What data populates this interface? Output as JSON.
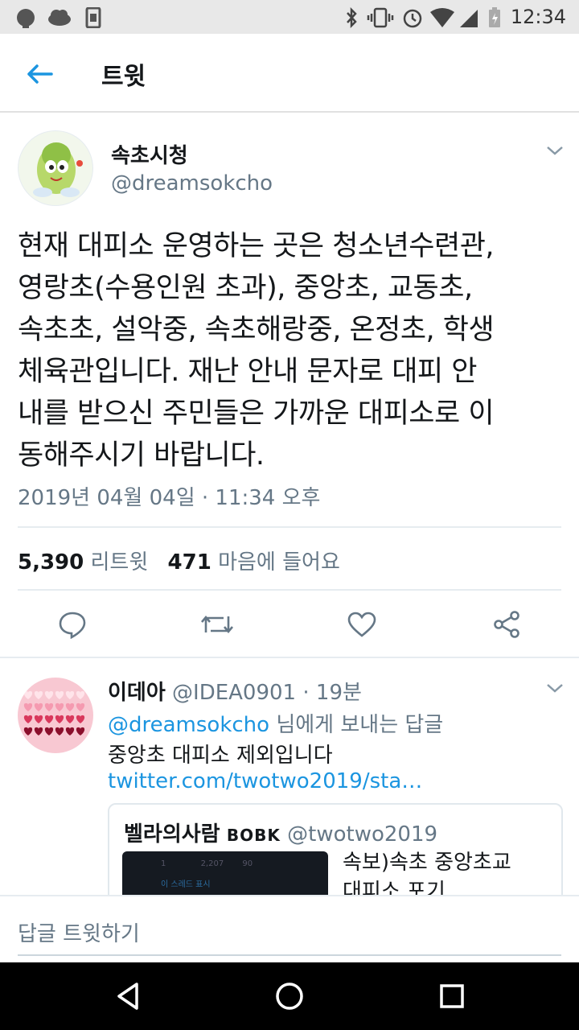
{
  "status_bar": {
    "time": "12:34",
    "icons": [
      "notification-icon",
      "cloud-icon",
      "sim-icon",
      "bluetooth-icon",
      "vibrate-icon",
      "alarm-icon",
      "wifi-icon",
      "signal-icon",
      "battery-icon"
    ]
  },
  "header": {
    "title": "트윗",
    "back_icon": "back-arrow-icon"
  },
  "tweet": {
    "display_name": "속초시청",
    "handle": "@dreamsokcho",
    "text_lines": [
      "현재 대피소 운영하는 곳은 청소년수련관,",
      "영랑초(수용인원 초과), 중앙초, 교동초,",
      "속초초, 설악중, 속초해랑중, 온정초, 학생",
      "체육관입니다. 재난 안내 문자로 대피 안",
      "내를 받으신 주민들은 가까운 대피소로 이",
      "동해주시기 바랍니다."
    ],
    "timestamp": "2019년 04월 04일 · 11:34 오후",
    "retweet_count": "5,390",
    "retweet_label": "리트윗",
    "like_count": "471",
    "like_label": "마음에 들어요",
    "actions": [
      "reply-icon",
      "retweet-icon",
      "like-icon",
      "share-icon"
    ]
  },
  "reply": {
    "display_name": "이데아",
    "handle": "@IDEA0901",
    "time": "· 19분",
    "reply_to_handle": "@dreamsokcho",
    "reply_to_suffix": " 님에게 보내는 답글",
    "text": "중앙초 대피소 제외입니다",
    "link": "twitter.com/twotwo2019/sta…",
    "quoted": {
      "display_name": "벨라의사람",
      "badge": "BOBK",
      "handle": "@twotwo2019",
      "text_line1": "속보)속초 중앙초교",
      "text_line2": "대피소 포기",
      "thumb_counts": [
        "1",
        "2,207",
        "90"
      ],
      "thumb_caption": "이 스레드 표시"
    }
  },
  "compose": {
    "placeholder": "답글 트윗하기"
  },
  "nav": [
    "back-triangle-icon",
    "home-circle-icon",
    "recents-square-icon"
  ],
  "colors": {
    "accent": "#1b95e0",
    "muted": "#657786",
    "divider": "#e6ecf0"
  }
}
